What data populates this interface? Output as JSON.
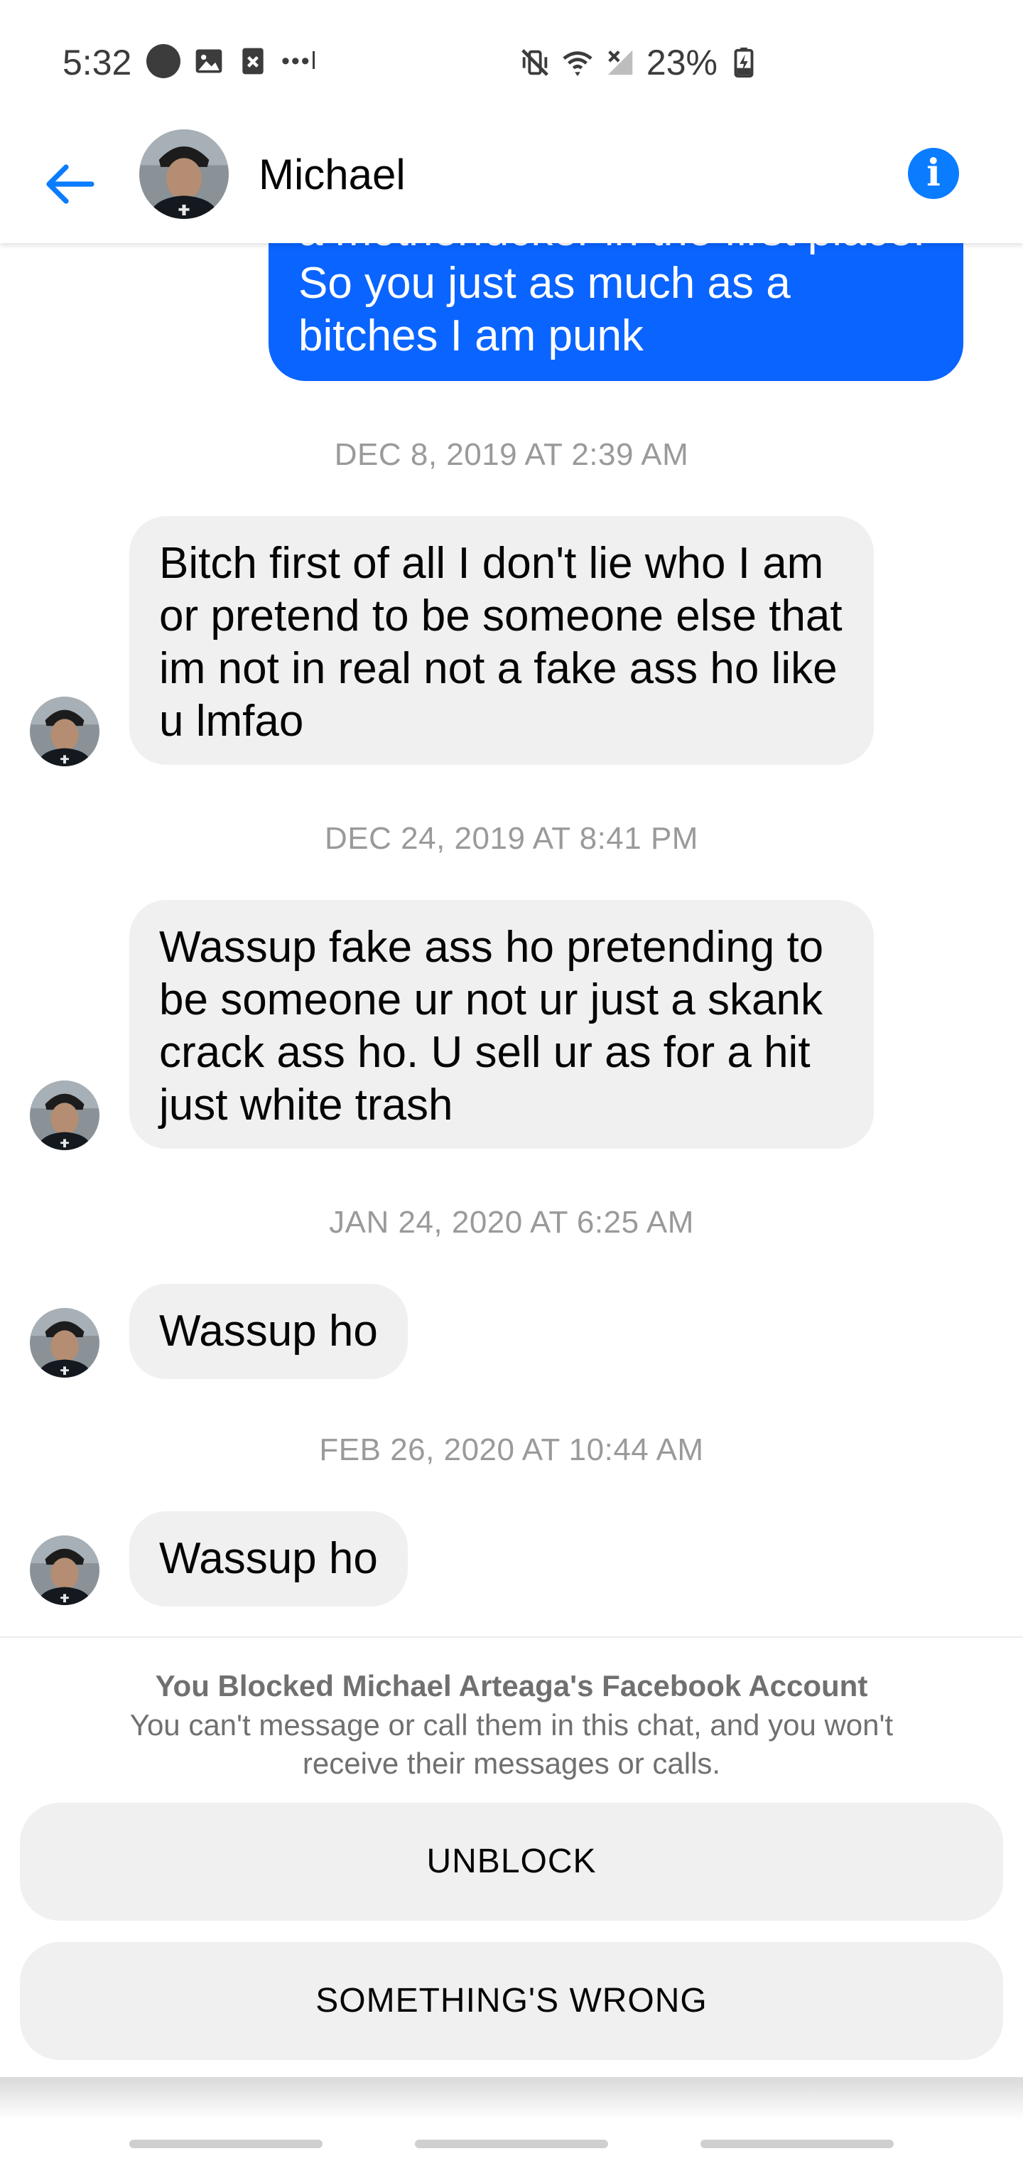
{
  "status_bar": {
    "time": "5:32",
    "left_icons": [
      "circle-icon",
      "image-icon",
      "x-badge-icon",
      "more-dots-icon"
    ],
    "more_glyph": "•••l",
    "right_icons": [
      "mute-vibrate-icon",
      "wifi-icon",
      "cellular-no-signal-icon",
      "battery-charging-icon"
    ],
    "battery_percent": "23%"
  },
  "header": {
    "back_icon": "back-arrow-icon",
    "contact_name": "Michael",
    "info_icon": "info-icon",
    "info_glyph": "i"
  },
  "messages": {
    "outgoing": {
      "text": "a motherfucker in the first place.\nSo you just as much as a\nbitches I am punk"
    },
    "ts1": "DEC 8, 2019 AT 2:39 AM",
    "msg1": "Bitch first of all I don't lie who I am or pretend to be someone else that im not in real not a fake ass ho like u lmfao",
    "ts2": "DEC 24, 2019 AT 8:41 PM",
    "msg2": "Wassup fake ass ho pretending to be someone ur not ur just a skank crack ass ho. U sell ur as for a hit just white trash",
    "ts3": "JAN 24, 2020 AT 6:25 AM",
    "msg3": "Wassup ho",
    "ts4": "FEB 26, 2020 AT 10:44 AM",
    "msg4": "Wassup ho"
  },
  "blocked": {
    "title": "You Blocked Michael Arteaga's Facebook Account",
    "description": "You can't message or call them in this chat, and you won't receive their messages or calls.",
    "unblock_label": "UNBLOCK",
    "something_wrong_label": "SOMETHING'S WRONG"
  },
  "colors": {
    "accent_blue": "#0a7cff",
    "outgoing_bubble": "#0a64ff",
    "incoming_bubble": "#f0f0f0",
    "muted_text": "#9a9a9a"
  }
}
